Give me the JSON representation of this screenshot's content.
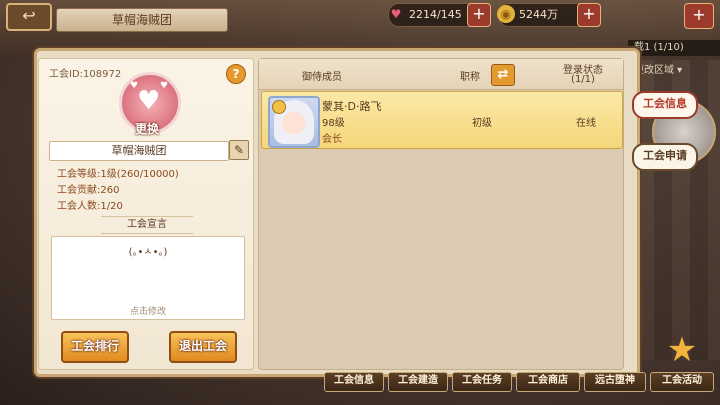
{
  "topbar": {
    "title": "草帽海贼团",
    "hearts": "2214/145",
    "coins": "5244万",
    "plus": "+",
    "back_glyph": "↩",
    "close_glyph": "+"
  },
  "side": {
    "server_text": "载1 (1/10)",
    "region_text": "更改区域 ▾",
    "tabs": [
      "工会信息",
      "工会申请"
    ]
  },
  "guild": {
    "id_label": "工会ID:108972",
    "help": "?",
    "change_label": "更换",
    "name": "草帽海贼团",
    "edit_glyph": "✎",
    "stats": [
      "工会等级:1级(260/10000)",
      "工会贡献:260",
      "工会人数:1/20"
    ],
    "declaration_title": "工会宣言",
    "declaration_text": "(｡•ㅅ•｡)",
    "declaration_hint": "点击修改",
    "rank_button": "工会排行",
    "leave_button": "退出工会"
  },
  "members": {
    "headers": {
      "member": "御侍成员",
      "rank": "职称",
      "login": "登录状态",
      "login_count": "(1/1)"
    },
    "swap_glyph": "⇄",
    "rows": [
      {
        "name": "蒙其·D·路飞",
        "level": "98级",
        "role": "会长",
        "rank": "初级",
        "status": "在线"
      }
    ]
  },
  "bottom_nav": [
    "工会信息",
    "工会建造",
    "工会任务",
    "工会商店",
    "远古堕神",
    "工会活动"
  ],
  "colors": {
    "accent": "#e08a1e",
    "frame": "#c8a774",
    "active_tab": "#b23a2a"
  }
}
